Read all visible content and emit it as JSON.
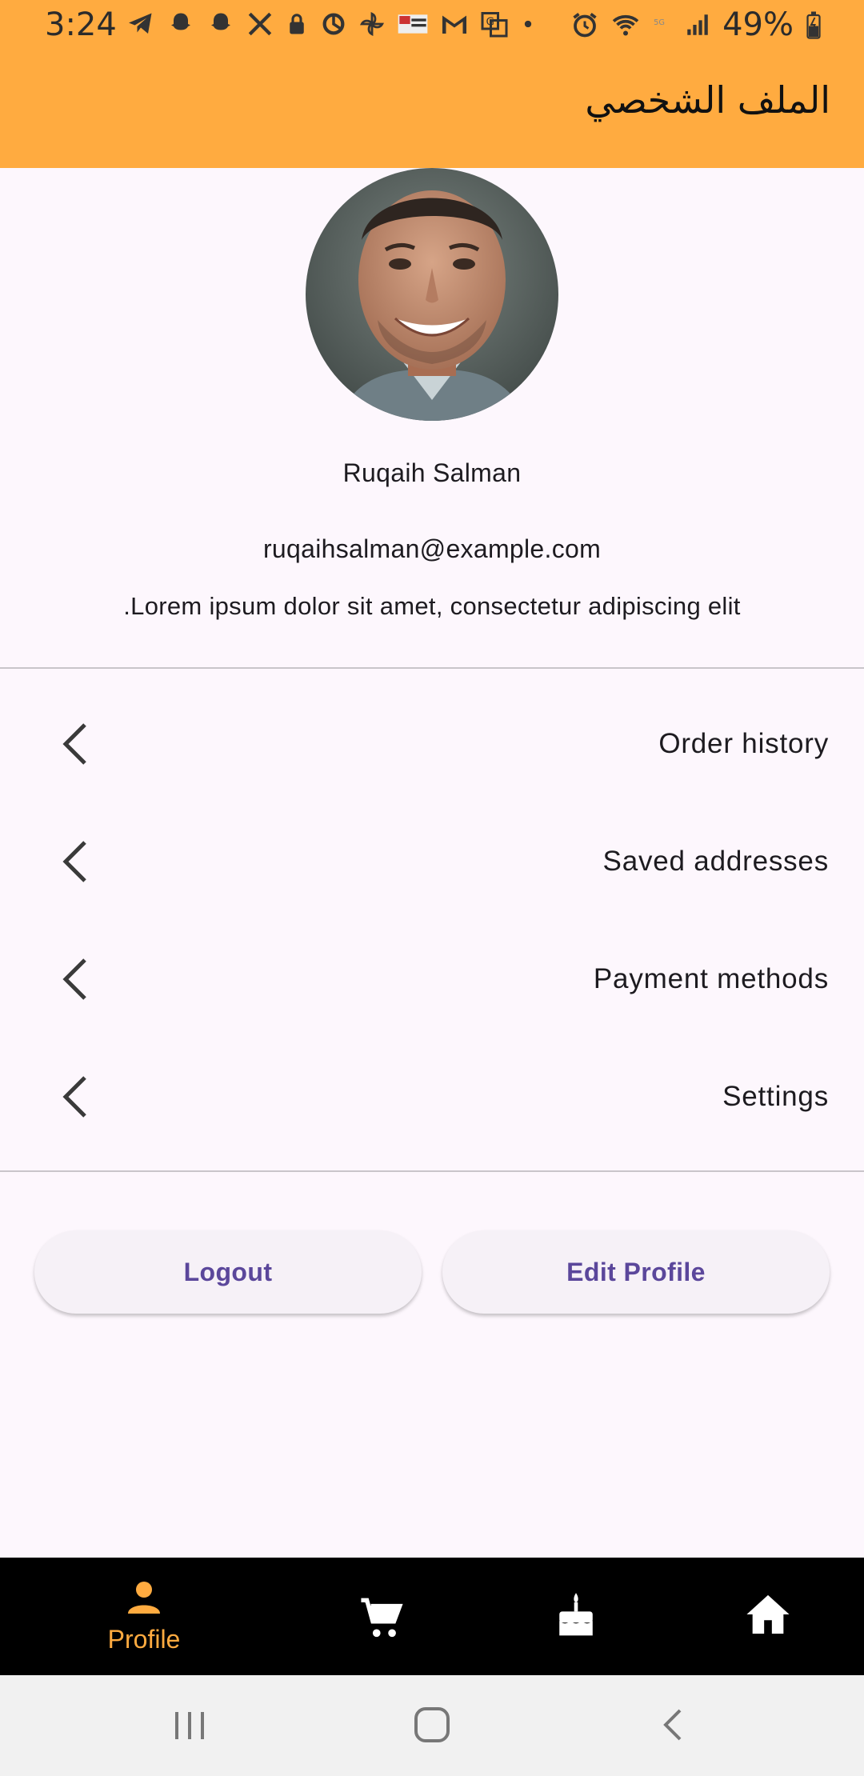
{
  "status_bar": {
    "time": "3:24",
    "battery": "49%",
    "background": "#ffab40"
  },
  "app_bar": {
    "title": "الملف الشخصي",
    "background": "#ffab40"
  },
  "profile": {
    "avatar": "person-photo",
    "name": "Ruqaih Salman",
    "email": "ruqaihsalman@example.com",
    "bio": ".Lorem ipsum dolor sit amet, consectetur adipiscing elit"
  },
  "menu": {
    "items": [
      {
        "label": "Order history",
        "icon": "chevron-left-icon"
      },
      {
        "label": "Saved addresses",
        "icon": "chevron-left-icon"
      },
      {
        "label": "Payment methods",
        "icon": "chevron-left-icon"
      },
      {
        "label": "Settings",
        "icon": "chevron-left-icon"
      }
    ]
  },
  "actions": {
    "logout_label": "Logout",
    "edit_profile_label": "Edit Profile",
    "button_text_color": "#5b479b"
  },
  "bottom_nav": {
    "items": [
      {
        "label": "Profile",
        "icon": "person-icon",
        "active": true
      },
      {
        "label": "",
        "icon": "cart-icon",
        "active": false
      },
      {
        "label": "",
        "icon": "cake-icon",
        "active": false
      },
      {
        "label": "",
        "icon": "home-icon",
        "active": false
      }
    ],
    "active_color": "#ffab40"
  },
  "system_nav": {
    "buttons": [
      "recents-icon",
      "home-circle-icon",
      "back-icon"
    ]
  }
}
